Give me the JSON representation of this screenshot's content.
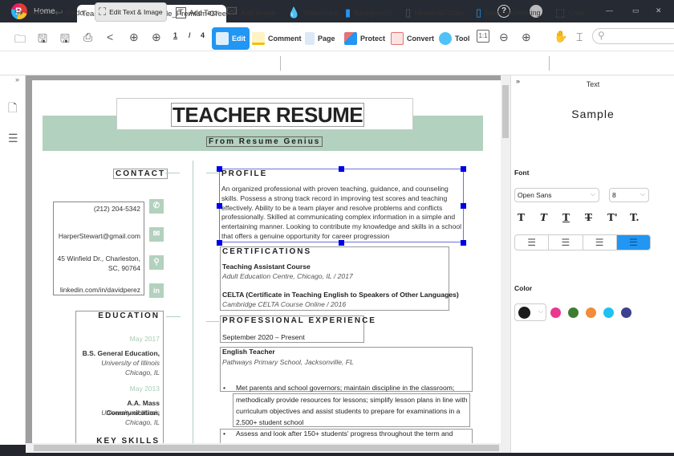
{
  "window": {
    "home_tab": "Home",
    "doc_tab": "Teacher-Resume-Example_Premium-Green",
    "close_tab": "×",
    "help": "?",
    "minimize": "—",
    "maximize": "▭",
    "close": "✕"
  },
  "toolbar": {
    "page_current": "1",
    "page_sep": "/",
    "page_total": "4",
    "tabs": [
      {
        "label": "Edit",
        "active": true
      },
      {
        "label": "Comment"
      },
      {
        "label": "Page"
      },
      {
        "label": "Protect"
      },
      {
        "label": "Convert"
      },
      {
        "label": "Tool"
      }
    ],
    "search_placeholder": ""
  },
  "edit_toolbar": {
    "redo": "Redo",
    "undo": "Undo",
    "edit_text_image": "Edit Text & Image",
    "add_text": "Add Text",
    "add_image": "Add Image",
    "watermark": "Watermark",
    "background": "Background",
    "header_footer": "Header&Footer",
    "bates": "Bates Numbering",
    "crop": "Crop"
  },
  "resume": {
    "title": "TEACHER RESUME",
    "subtitle": "From Resume Genius",
    "contact_heading": "CONTACT",
    "phone": "(212) 204-5342",
    "email": "HarperStewart@gmail.com",
    "address_1": "45 Winfield Dr., Charleston,",
    "address_2": "SC, 90764",
    "linkedin": "linkedin.com/in/davidperez",
    "education_heading": "EDUCATION",
    "education": [
      {
        "date": "May 2017",
        "degree": "B.S. General Education,",
        "school": "University of Illinois",
        "city": "Chicago, IL"
      },
      {
        "date": "May 2013",
        "degree": "A.A. Mass Communication,",
        "school": "University of Illinois",
        "city": "Chicago, IL"
      }
    ],
    "skills_heading": "KEY SKILLS",
    "profile_heading": "PROFILE",
    "profile_text": "An organized professional with proven teaching, guidance, and counseling skills. Possess a strong track record in improving test scores and teaching effectively. Ability to be a team player and resolve problems and conflicts professionally. Skilled at communicating complex information in a simple and entertaining manner. Looking to contribute my knowledge and skills in a school that offers a genuine opportunity for career progression",
    "cert_heading": "CERTIFICATIONS",
    "certs": [
      {
        "name": "Teaching Assistant Course",
        "detail": "Adult Education Centre, Chicago, IL / 2017"
      },
      {
        "name": "CELTA (Certificate in Teaching English to Speakers of Other Languages)",
        "detail": "Cambridge CELTA Course Online / 2016"
      }
    ],
    "exp_heading": "PROFESSIONAL EXPERIENCE",
    "exp_date": "September 2020 – Present",
    "job_title": "English Teacher",
    "job_place": "Pathways Primary School, Jacksonville, FL",
    "bullet_1_line1": "Met parents and school governors; maintain discipline in the classroom;",
    "bullet_1_rest": "methodically provide resources for lessons; simplify lesson plans in line with curriculum objectives and assist students to prepare for examinations in a 2,500+ student school",
    "bullet_2": "Assess and look after 150+ students' progress throughout the term and"
  },
  "panel": {
    "title": "Text",
    "sample": "Sample",
    "font_label": "Font",
    "font_family": "Open Sans",
    "font_size": "8",
    "color_label": "Color",
    "alignment": "justify",
    "current_color": "#1b1b1b",
    "swatches": [
      "#e8398e",
      "#3e7d32",
      "#f28c38",
      "#1fc1f2",
      "#3d3f8f"
    ]
  }
}
